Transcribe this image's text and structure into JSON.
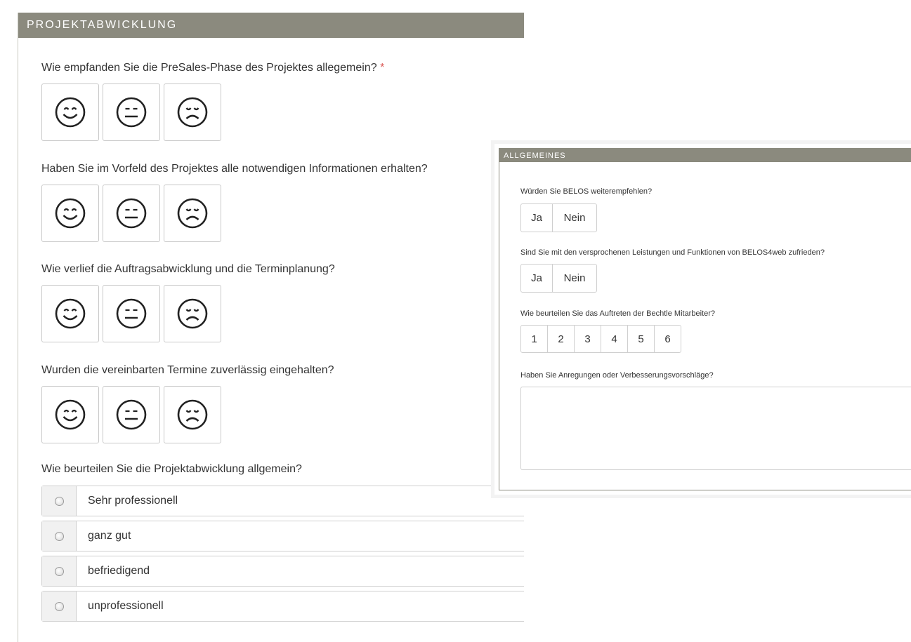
{
  "left_panel": {
    "title": "PROJEKTABWICKLUNG",
    "questions": [
      {
        "label": "Wie empfanden Sie die PreSales-Phase des Projektes allegemein?",
        "required_mark": "*"
      },
      {
        "label": "Haben Sie im Vorfeld des Projektes alle notwendigen Informationen erhalten?"
      },
      {
        "label": "Wie verlief die Auftragsabwicklung und die Terminplanung?"
      },
      {
        "label": "Wurden die vereinbarten Termine zuverlässig eingehalten?"
      }
    ],
    "smiley_icons": [
      "smiley-happy-icon",
      "smiley-neutral-icon",
      "smiley-sad-icon"
    ],
    "overall_question": "Wie beurteilen Sie die Projektabwicklung allgemein?",
    "overall_options": [
      "Sehr professionell",
      "ganz gut",
      "befriedigend",
      "unprofessionell"
    ]
  },
  "right_panel": {
    "title": "ALLGEMEINES",
    "q1": {
      "label": "Würden Sie BELOS weiterempfehlen?",
      "options": [
        "Ja",
        "Nein"
      ]
    },
    "q2": {
      "label": "Sind Sie mit den versprochenen Leistungen und Funktionen von BELOS4web zufrieden?",
      "options": [
        "Ja",
        "Nein"
      ]
    },
    "q3": {
      "label": "Wie beurteilen Sie das Auftreten der Bechtle Mitarbeiter?",
      "options": [
        "1",
        "2",
        "3",
        "4",
        "5",
        "6"
      ]
    },
    "q4": {
      "label": "Haben Sie Anregungen oder Verbesserungsvorschläge?"
    }
  },
  "colors": {
    "header_bg": "#8b8a7e",
    "required": "#d9534f",
    "border": "#cfcfcf"
  }
}
